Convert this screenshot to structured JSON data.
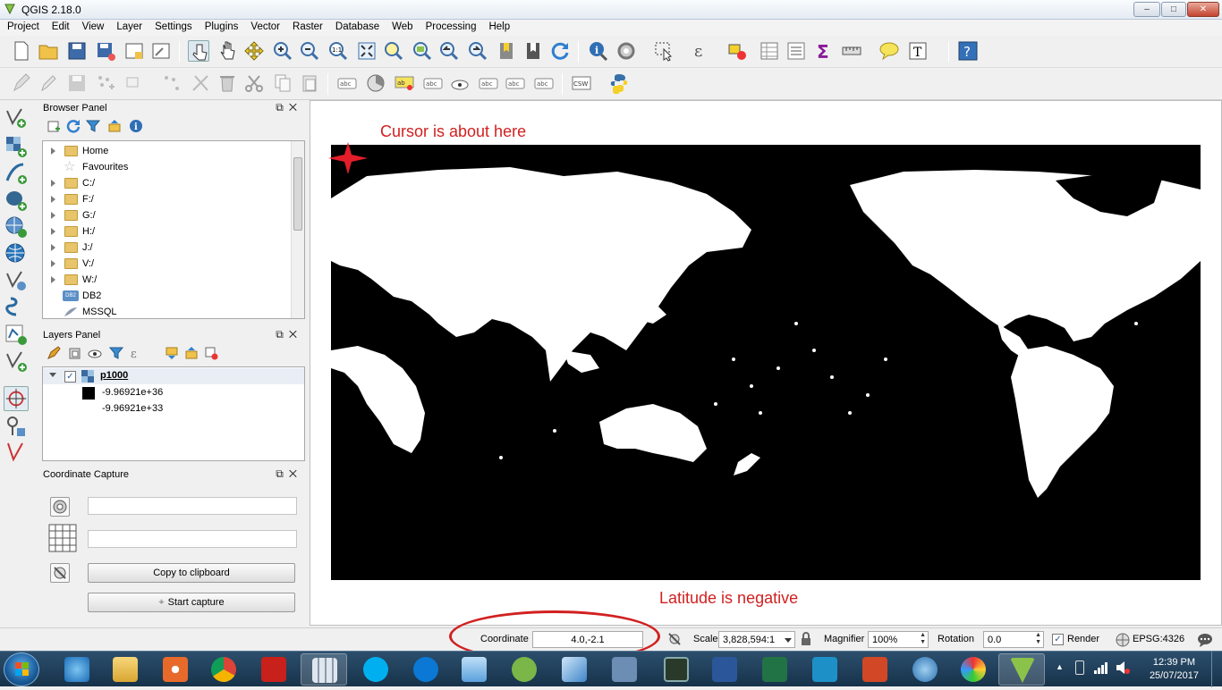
{
  "window": {
    "title": "QGIS 2.18.0",
    "minimize": "–",
    "maximize": "□",
    "close": "✕"
  },
  "menu": [
    "Project",
    "Edit",
    "View",
    "Layer",
    "Settings",
    "Plugins",
    "Vector",
    "Raster",
    "Database",
    "Web",
    "Processing",
    "Help"
  ],
  "browser_panel": {
    "title": "Browser Panel",
    "items": [
      {
        "label": "Home",
        "icon": "folder-icon"
      },
      {
        "label": "Favourites",
        "icon": "star-icon"
      },
      {
        "label": "C:/",
        "icon": "folder-icon"
      },
      {
        "label": "F:/",
        "icon": "folder-icon"
      },
      {
        "label": "G:/",
        "icon": "folder-icon"
      },
      {
        "label": "H:/",
        "icon": "folder-icon"
      },
      {
        "label": "J:/",
        "icon": "folder-icon"
      },
      {
        "label": "V:/",
        "icon": "folder-icon"
      },
      {
        "label": "W:/",
        "icon": "folder-icon"
      },
      {
        "label": "DB2",
        "icon": "db2-icon"
      },
      {
        "label": "MSSQL",
        "icon": "mssql-icon"
      }
    ]
  },
  "layers_panel": {
    "title": "Layers Panel",
    "layer_name": "p1000",
    "legend": [
      "-9.96921e+36",
      "-9.96921e+33"
    ]
  },
  "coordinate_capture": {
    "title": "Coordinate Capture",
    "copy_label": "Copy to clipboard",
    "start_label": "Start capture"
  },
  "annotations": {
    "cursor": "Cursor is about here",
    "latitude": "Latitude is negative"
  },
  "statusbar": {
    "coordinate_label": "Coordinate",
    "coordinate_value": "4.0,-2.1",
    "scale_label": "Scale",
    "scale_value": "3,828,594:1",
    "magnifier_label": "Magnifier",
    "magnifier_value": "100%",
    "rotation_label": "Rotation",
    "rotation_value": "0.0",
    "render_label": "Render",
    "crs": "EPSG:4326"
  },
  "taskbar": {
    "time": "12:39 PM",
    "date": "25/07/2017",
    "apps": [
      "internet-explorer",
      "file-explorer",
      "media-player",
      "chrome",
      "acrobat",
      "calculator",
      "skype",
      "skype-business",
      "notepad",
      "pen-app",
      "remote-desktop",
      "network-app",
      "terminal",
      "word",
      "excel",
      "teams-app",
      "powerpoint",
      "globe-app",
      "paint",
      "qgis"
    ]
  },
  "colors": {
    "accent_red": "#d22020",
    "map_background": "#000000"
  }
}
